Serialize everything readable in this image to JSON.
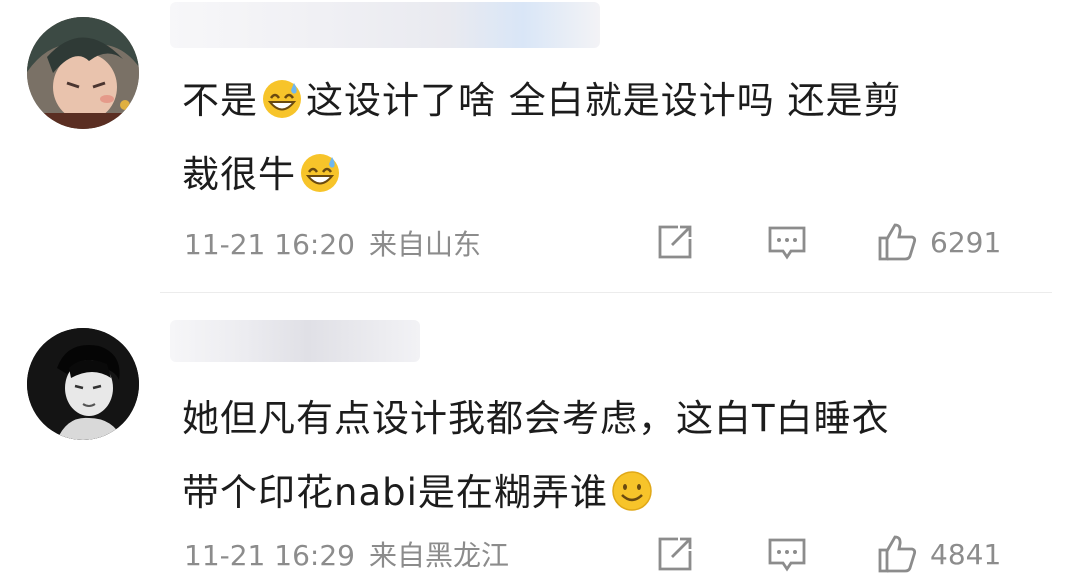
{
  "comments": [
    {
      "text_line1_a": "不是",
      "text_line1_b": "这设计了啥 全白就是设计吗 还是剪",
      "text_line2": "裁很牛",
      "time": "11-21 16:20",
      "location": "来自山东",
      "likes": "6291",
      "emoji": "sweat-smile-emoji"
    },
    {
      "text_line1": "她但凡有点设计我都会考虑，这白T白睡衣",
      "text_line2": "带个印花nabi是在糊弄谁",
      "time": "11-21 16:29",
      "location": "来自黑龙江",
      "likes": "4841",
      "emoji": "smile-emoji"
    }
  ],
  "icons": {
    "share": "share-icon",
    "reply": "comment-icon",
    "like": "thumbs-up-icon"
  },
  "colors": {
    "text": "#1c1c1c",
    "meta": "#8c8c8c",
    "emoji_face": "#f7c42a"
  }
}
